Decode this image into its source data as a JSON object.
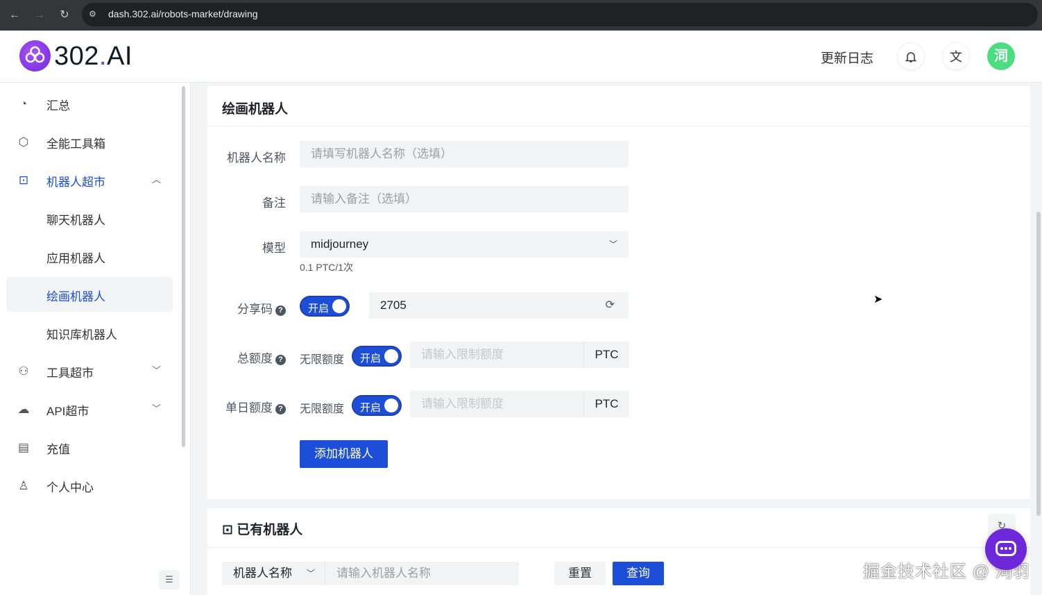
{
  "browser": {
    "url": "dash.302.ai/robots-market/drawing",
    "back_icon": "←",
    "forward_icon": "→",
    "reload_icon": "↻",
    "site_icon": "⚙"
  },
  "header": {
    "logo_text_main": "302",
    "logo_text_dot": ".",
    "logo_text_end": "AI",
    "changelog": "更新日志",
    "bell_icon": "🔔",
    "translate_icon": "文",
    "avatar_text": "泀"
  },
  "sidebar": {
    "items": [
      {
        "label": "汇总",
        "icon": "◔"
      },
      {
        "label": "全能工具箱",
        "icon": "⬡"
      },
      {
        "label": "机器人超市",
        "icon": "⊡",
        "chevron": "︿"
      },
      {
        "label": "聊天机器人"
      },
      {
        "label": "应用机器人"
      },
      {
        "label": "绘画机器人"
      },
      {
        "label": "知识库机器人"
      },
      {
        "label": "工具超市",
        "icon": "⚇",
        "chevron": "﹀"
      },
      {
        "label": "API超市",
        "icon": "☁",
        "chevron": "﹀"
      },
      {
        "label": "充值",
        "icon": "▤"
      },
      {
        "label": "个人中心",
        "icon": "♙"
      }
    ],
    "collapse_icon": "☰"
  },
  "form": {
    "title": "绘画机器人",
    "name_label": "机器人名称",
    "name_placeholder": "请填写机器人名称（选填）",
    "remark_label": "备注",
    "remark_placeholder": "请输入备注（选填）",
    "model_label": "模型",
    "model_value": "midjourney",
    "model_arrow": "﹀",
    "model_price": "0.1 PTC/1次",
    "share_label": "分享码",
    "share_toggle": "开启",
    "share_code": "2705",
    "share_refresh_icon": "⟳",
    "total_label": "总额度",
    "unlimited_label": "无限额度",
    "total_toggle": "开启",
    "total_placeholder": "请输入限制额度",
    "total_unit": "PTC",
    "daily_label": "单日额度",
    "daily_unlimited_label": "无限额度",
    "daily_toggle": "开启",
    "daily_placeholder": "请输入限制额度",
    "daily_unit": "PTC",
    "help_icon": "?",
    "submit": "添加机器人"
  },
  "existing": {
    "title": "已有机器人",
    "title_icon": "⊡",
    "refresh_icon": "↻",
    "filter_field": "机器人名称",
    "filter_arrow": "﹀",
    "search_placeholder": "请输入机器人名称",
    "reset": "重置",
    "query": "查询"
  },
  "watermark": "掘金技术社区 @ 泀羽",
  "colors": {
    "primary": "#1d4ed8",
    "brand_purple": "#7c3aed",
    "avatar_green": "#4ade80"
  }
}
